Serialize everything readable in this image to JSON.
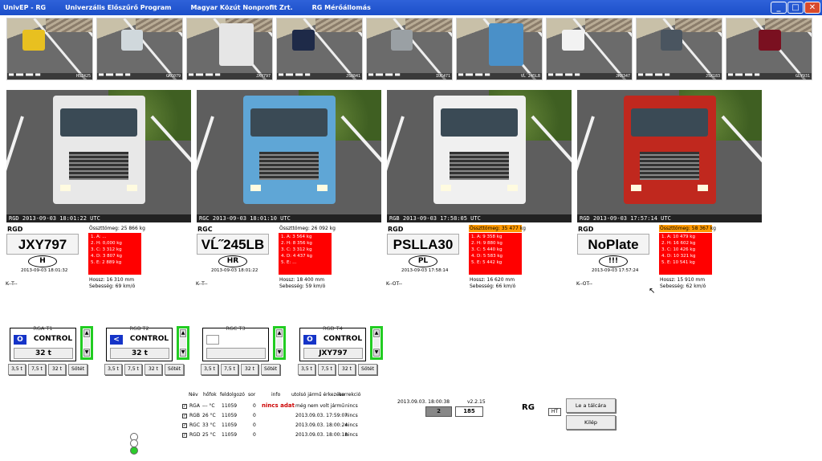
{
  "window": {
    "app": "UnivEP - RG",
    "program": "Univerzális Előszűrő Program",
    "company": "Magyar Közút Nonprofit Zrt.",
    "station": "RG Mérőállomás"
  },
  "thumbnails": [
    {
      "plate": "HSZ425",
      "color": "#e8c020"
    },
    {
      "plate": "GKC079",
      "color": "#d0d8dc"
    },
    {
      "plate": "JXY797",
      "color": "#e6e6e6"
    },
    {
      "plate": "JSX841",
      "color": "#1e2a48"
    },
    {
      "plate": "IUC471",
      "color": "#9aa0a4"
    },
    {
      "plate": "VĹ˝245LB",
      "color": "#4a90c8"
    },
    {
      "plate": "JKR347",
      "color": "#f2f2f2"
    },
    {
      "plate": "JSX183",
      "color": "#4a5560"
    },
    {
      "plate": "GLY931",
      "color": "#7a1020"
    }
  ],
  "lanes": [
    {
      "cam": "RGD 2013-09-03 18:01:22 UTC",
      "code": "RGD",
      "plate": "JXY797",
      "country": "H",
      "time": "2013-09-03 18:01:32",
      "class": "K--T--",
      "total": "Összttömeg: 25 866 kg",
      "axles": [
        "1. A: ...",
        "2. H: 0,000 kg",
        "3. C: 3 312 kg",
        "4. D: 3 807 kg",
        "5. E: 2 889 kg"
      ],
      "length": "Hossz: 16 310 mm",
      "speed": "Sebesség: 69 km/ó",
      "truck": "#e8e8e8",
      "total_warn": false
    },
    {
      "cam": "RGC 2013-09-03 18:01:10 UTC",
      "code": "RGC",
      "plate": "VĹ˝245LB",
      "country": "HR",
      "time": "2013-09-03 18:01:22",
      "class": "K--T--",
      "total": "Összttömeg: 26 092 kg",
      "axles": [
        "1. A: 3 564 kg",
        "2. H: 8 356 kg",
        "3. C: 3 312 kg",
        "4. D: 4 437 kg",
        "5. E: ..."
      ],
      "length": "Hossz: 18 400 mm",
      "speed": "Sebesség: 59 km/ó",
      "truck": "#5fa6d6",
      "total_warn": false
    },
    {
      "cam": "RGB 2013-09-03 17:58:05 UTC",
      "code": "RGD",
      "plate": "PSLLA30",
      "country": "PL",
      "time": "2013-09-03 17:58:14",
      "class": "K--OT--",
      "total": "Összttömeg: 35 477 kg",
      "axles": [
        "1. A: 9 358 kg",
        "2. H: 9 880 kg",
        "3. C: 5 440 kg",
        "4. D: 5 583 kg",
        "5. E: 5 442 kg"
      ],
      "length": "Hossz: 16 620 mm",
      "speed": "Sebesség: 66 km/ó",
      "truck": "#f0f0f0",
      "total_warn": true
    },
    {
      "cam": "RGD 2013-09-03 17:57:14 UTC",
      "code": "RGD",
      "plate": "NoPlate",
      "country": "!!!",
      "time": "2013-09-03 17:57:24",
      "class": "K--OT--",
      "total": "Összttömeg: 58 367 kg",
      "axles": [
        "1. A: 10 479 kg",
        "2. H: 16 602 kg",
        "3. C: 10 426 kg",
        "4. D: 10 321 kg",
        "5. E: 10 541 kg"
      ],
      "length": "Hossz: 15 910 mm",
      "speed": "Sebesség: 62 km/ó",
      "truck": "#c0281e",
      "total_warn": true
    }
  ],
  "controls": [
    {
      "title": "RGA T1",
      "indicator": "O",
      "mode": "CONTROL",
      "value": "32 t",
      "buttons": [
        "3,5 t",
        "7,5 t",
        "32 t",
        "Sötét"
      ]
    },
    {
      "title": "RGB T2",
      "indicator": "<",
      "mode": "CONTROL",
      "value": "32 t",
      "buttons": [
        "3,5 t",
        "7,5 t",
        "32 t",
        "Sötét"
      ]
    },
    {
      "title": "RGC T3",
      "indicator": "",
      "mode": "",
      "value": "",
      "buttons": [
        "3,5 t",
        "7,5 t",
        "32 t",
        "Sötét"
      ]
    },
    {
      "title": "RGD T4",
      "indicator": "O",
      "mode": "CONTROL",
      "value": "JXY797",
      "buttons": [
        "3,5 t",
        "7,5 t",
        "32 t",
        "Sötét"
      ]
    }
  ],
  "status_table": {
    "headers": [
      "Név",
      "hőfok",
      "feldolgozó",
      "sor",
      "info",
      "utolsó jármű érkezése",
      "korrekció"
    ],
    "info": "nincs adat",
    "rows": [
      {
        "name": "RGA",
        "temp": "--- °C",
        "proc": "11059",
        "queue": "0",
        "last": "még nem volt jármű",
        "corr": "nincs"
      },
      {
        "name": "RGB",
        "temp": "26 °C",
        "proc": "11059",
        "queue": "0",
        "last": "2013.09.03. 17:59:07",
        "corr": "nincs"
      },
      {
        "name": "RGC",
        "temp": "33 °C",
        "proc": "11059",
        "queue": "0",
        "last": "2013.09.03. 18:00:24",
        "corr": "nincs"
      },
      {
        "name": "RGD",
        "temp": "25 °C",
        "proc": "11059",
        "queue": "0",
        "last": "2013.09.03. 18:00:18",
        "corr": "nincs"
      }
    ]
  },
  "status": {
    "datetime": "2013.09.03. 18:00:38",
    "counter": "2",
    "total": "185",
    "version": "v2.2.15",
    "station": "RG",
    "flag": "HT"
  },
  "buttons": {
    "tray": "Le a tálcára",
    "exit": "Kilép"
  }
}
